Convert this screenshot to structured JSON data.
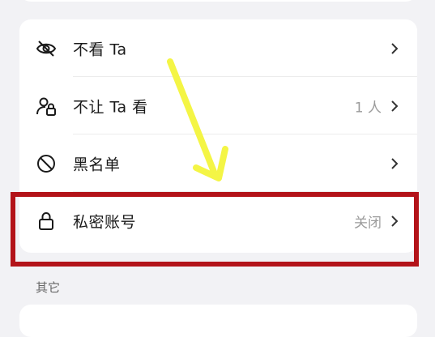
{
  "menu": {
    "items": [
      {
        "label": "不看 Ta",
        "value": "",
        "icon": "eye-off-icon"
      },
      {
        "label": "不让 Ta 看",
        "value": "1 人",
        "icon": "user-lock-icon"
      },
      {
        "label": "黑名单",
        "value": "",
        "icon": "block-icon"
      },
      {
        "label": "私密账号",
        "value": "关闭",
        "icon": "lock-icon"
      }
    ]
  },
  "section": {
    "title": "其它"
  },
  "annotation": {
    "highlight_color": "#b31319",
    "arrow_color": "#f4f545"
  }
}
